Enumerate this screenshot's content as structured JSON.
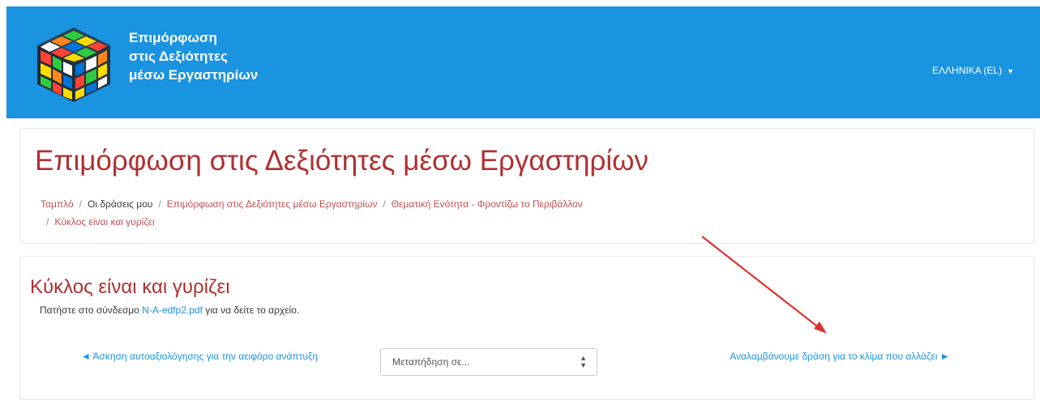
{
  "navbar": {
    "site_title_lines": [
      "Επιμόρφωση",
      "στις Δεξιότητες",
      "μέσω Εργαστηρίων"
    ],
    "language": "ΕΛΛΗΝΙΚΑ (EL)",
    "language_caret_icon": "caret-down-icon",
    "logo_icon": "rubiks-cube-logo"
  },
  "header": {
    "title": "Επιμόρφωση στις Δεξιότητες μέσω Εργαστηρίων",
    "breadcrumb": [
      "Ταμπλό",
      "Οι δράσεις μου",
      "Επιμόρφωση στις Δεξιότητες μέσω Εργαστηρίων",
      "Θεματική Ενότητα - Φροντίζω το Περιβάλλον",
      "Κύκλος είναι και γυρίζει"
    ],
    "breadcrumb_separator": "/"
  },
  "activity": {
    "title": "Κύκλος είναι και γυρίζει",
    "instruction_before": "Πατήστε στο σύνδεσμο",
    "file_link": "N-A-edfp2.pdf",
    "instruction_after": "για να δείτε το αρχείο."
  },
  "navigation": {
    "prev_arrow": "◄",
    "prev_label": "Άσκηση αυτοαξιολόγησης για την αειφόρο ανάπτυξη",
    "jump_placeholder": "Μεταπήδηση σε...",
    "next_label": "Αναλαμβάνουμε δράση για το κλίμα που αλλάζει",
    "next_arrow": "►"
  },
  "colors": {
    "navbar": "#1a93e0",
    "heading": "#b03030",
    "link": "#1a93e0",
    "annotation_arrow": "#e03030"
  }
}
